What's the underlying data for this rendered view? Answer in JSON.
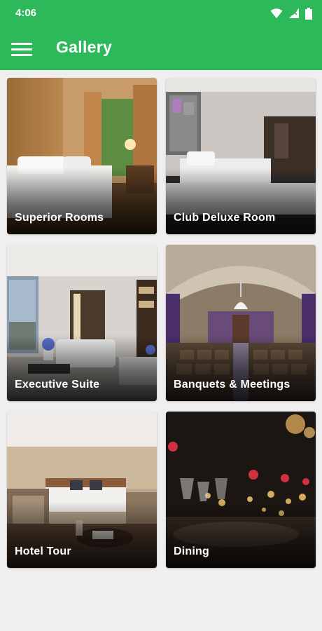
{
  "status_bar": {
    "time": "4:06",
    "icons": [
      "wifi-icon",
      "signal-off-icon",
      "battery-icon"
    ]
  },
  "app_bar": {
    "menu_icon": "hamburger-menu-icon",
    "title": "Gallery",
    "color": "#2db85a"
  },
  "gallery": {
    "items": [
      {
        "label": "Superior Rooms"
      },
      {
        "label": "Club Deluxe Room"
      },
      {
        "label": "Executive Suite"
      },
      {
        "label": "Banquets & Meetings"
      },
      {
        "label": "Hotel Tour"
      },
      {
        "label": "Dining"
      }
    ]
  }
}
